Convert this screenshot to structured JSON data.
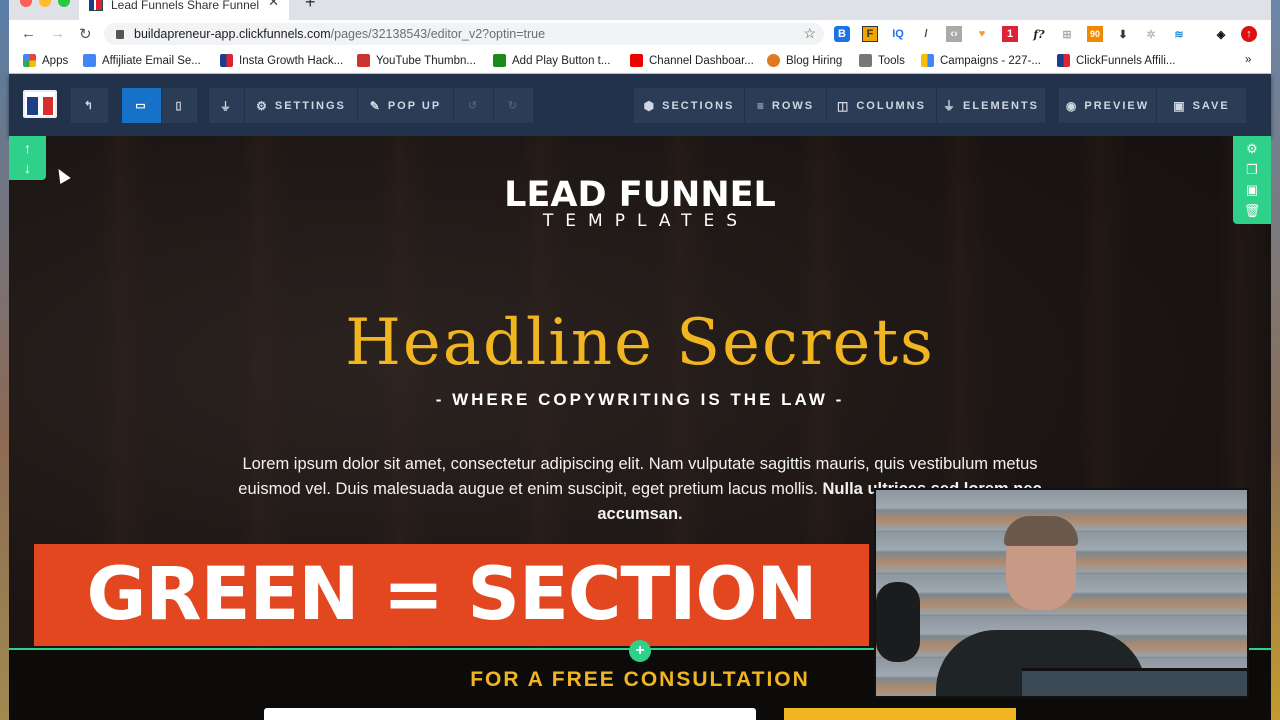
{
  "browser": {
    "tab_title": "Lead Funnels Share Funnel",
    "url_host": "buildapreneur-app.clickfunnels.com",
    "url_path": "/pages/32138543/editor_v2?optin=true",
    "extensions": [
      "bitly-icon",
      "gf-icon",
      "iq-icon",
      "eyedropper-icon",
      "code-icon",
      "heart-icon",
      "extension-badge-1",
      "font-icon",
      "ruler-icon",
      "tag-90",
      "download-icon",
      "loader-icon",
      "wave-icon",
      "layers-icon",
      "upload-icon"
    ],
    "extension_badges": {
      "red": "1",
      "orange": "90"
    },
    "bookmarks": [
      {
        "label": "Apps",
        "icon": "apps-grid-icon"
      },
      {
        "label": "Affijliate Email Se...",
        "icon": "doc-icon"
      },
      {
        "label": "Insta Growth Hack...",
        "icon": "clickfunnels-icon"
      },
      {
        "label": "YouTube Thumbn...",
        "icon": "youtube-thumb-icon"
      },
      {
        "label": "Add Play Button t...",
        "icon": "play-button-icon"
      },
      {
        "label": "Channel Dashboar...",
        "icon": "youtube-icon"
      },
      {
        "label": "Blog Hiring",
        "icon": "blog-icon"
      },
      {
        "label": "Tools",
        "icon": "folder-icon"
      },
      {
        "label": "Campaigns - 227-...",
        "icon": "google-ads-icon"
      },
      {
        "label": "ClickFunnels Affili...",
        "icon": "clickfunnels-icon"
      }
    ],
    "more": "»"
  },
  "toolbar": {
    "settings": "SETTINGS",
    "popup": "POP UP",
    "sections": "SECTIONS",
    "rows": "ROWS",
    "columns": "COLUMNS",
    "elements": "ELEMENTS",
    "preview": "PREVIEW",
    "save": "SAVE"
  },
  "page": {
    "logo_main": "LEAD FUNNEL",
    "logo_sub": "TEMPLATES",
    "headline": "Headline Secrets",
    "subhead": "- WHERE COPYWRITING IS THE LAW -",
    "body": "Lorem ipsum dolor sit amet, consectetur adipiscing elit. Nam vulputate sagittis mauris, quis vestibulum metus euismod vel. Duis malesuada augue et enim suscipit, eget pretium lacus mollis.",
    "body_bold": "Nulla ultrices sed lorem nec accumsan.",
    "cta": "FOR A FREE CONSULTATION"
  },
  "overlay": {
    "banner": "GREEN = SECTION"
  },
  "colors": {
    "section_green": "#2fd08a",
    "accent_gold": "#f0b521",
    "toolbar_bg": "#22324a",
    "active_blue": "#1572c8",
    "banner_red": "#e2471f"
  }
}
